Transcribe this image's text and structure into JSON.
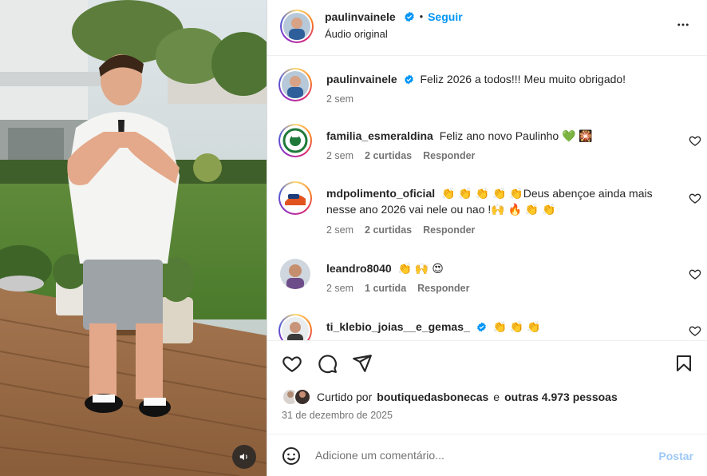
{
  "header": {
    "username": "paulinvainele",
    "follow_label": "Seguir",
    "dot": "•",
    "subtitle": "Áudio original",
    "more_icon": "more-horizontal-icon"
  },
  "caption": {
    "username": "paulinvainele",
    "text": "Feliz 2026 a todos!!! Meu muito obrigado!",
    "time": "2 sem"
  },
  "comments": [
    {
      "username": "familia_esmeraldina",
      "text": "Feliz ano novo Paulinho 💚 🎇",
      "time": "2 sem",
      "likes": "2 curtidas",
      "reply": "Responder"
    },
    {
      "username": "mdpolimento_oficial",
      "text": "👏 👏 👏 👏 👏Deus abençoe ainda mais nesse ano 2026 vai nele ou nao !🙌 🔥 👏 👏",
      "time": "2 sem",
      "likes": "2 curtidas",
      "reply": "Responder"
    },
    {
      "username": "leandro8040",
      "text": "👏 🙌 😍",
      "time": "2 sem",
      "likes": "1 curtida",
      "reply": "Responder"
    },
    {
      "username": "ti_klebio_joias__e_gemas_",
      "text": "👏 👏 👏",
      "time": "",
      "likes": "",
      "reply": ""
    }
  ],
  "likes": {
    "prefix": "Curtido por",
    "user": "boutiquedasbonecas",
    "middle": "e",
    "others": "outras 4.973 pessoas"
  },
  "date": "31 de dezembro de 2025",
  "composer": {
    "placeholder": "Adicione um comentário...",
    "post_label": "Postar"
  },
  "colors": {
    "accent": "#0095f6",
    "post_disabled": "#9dc8f7",
    "verified": "#0095f6",
    "text": "#262626",
    "muted": "#737373"
  }
}
